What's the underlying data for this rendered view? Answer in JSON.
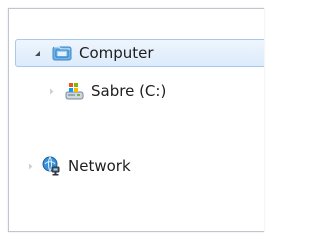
{
  "tree": {
    "computer": {
      "label": "Computer",
      "expanded": true,
      "selected": true,
      "icon": "computer-folder-icon"
    },
    "sabre_drive": {
      "label": "Sabre (C:)",
      "expanded": false,
      "icon": "windows-drive-icon"
    },
    "network": {
      "label": "Network",
      "expanded": false,
      "icon": "network-globe-icon"
    }
  },
  "colors": {
    "selection_fill": "#dcebfc",
    "selection_border": "#a7c9ee",
    "text": "#1e1e1e",
    "folder_icon": "#6fb4e8",
    "network_icon": "#2e83c8"
  }
}
